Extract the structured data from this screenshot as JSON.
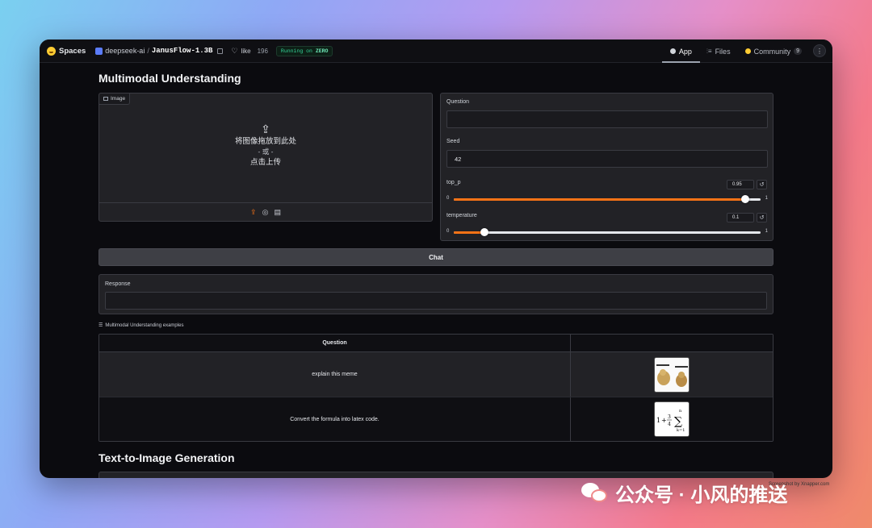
{
  "topbar": {
    "brand": "Spaces",
    "org": "deepseek-ai",
    "slash": "/",
    "repo": "JanusFlow-1.3B",
    "like_label": "like",
    "like_count": "196",
    "status_prefix": "Running on",
    "status_hw": "ZERO",
    "tabs": [
      {
        "label": "App",
        "active": true
      },
      {
        "label": "Files",
        "active": false
      },
      {
        "label": "Community",
        "badge": "9",
        "active": false
      }
    ],
    "menu_glyph": "⋮"
  },
  "understanding": {
    "title": "Multimodal Understanding",
    "image": {
      "label": "Image",
      "drop_line1": "将图像拖放到此处",
      "drop_or": "- 或 -",
      "drop_line2": "点击上传"
    },
    "question_label": "Question",
    "question_value": "",
    "seed_label": "Seed",
    "seed_value": "42",
    "top_p": {
      "label": "top_p",
      "value": "0.95",
      "min": "0",
      "max": "1",
      "fraction": 0.95
    },
    "temperature": {
      "label": "temperature",
      "value": "0.1",
      "min": "0",
      "max": "1",
      "fraction": 0.1
    },
    "chat_label": "Chat",
    "response_label": "Response",
    "response_value": ""
  },
  "examples": {
    "label": "Multimodal Understanding examples",
    "header": "Question",
    "rows": [
      {
        "text": "explain this meme",
        "thumb": "meme-image"
      },
      {
        "text": "Convert the formula into latex code.",
        "thumb": "formula-image"
      }
    ]
  },
  "generation": {
    "title": "Text-to-Image Generation"
  },
  "watermark": {
    "text": "公众号 · 小风的推送",
    "small": "Screenshot by Xnapper.com"
  },
  "colors": {
    "accent": "#f97316",
    "status_green": "#34d399",
    "panel": "#222226",
    "background": "#0b0b0f"
  }
}
